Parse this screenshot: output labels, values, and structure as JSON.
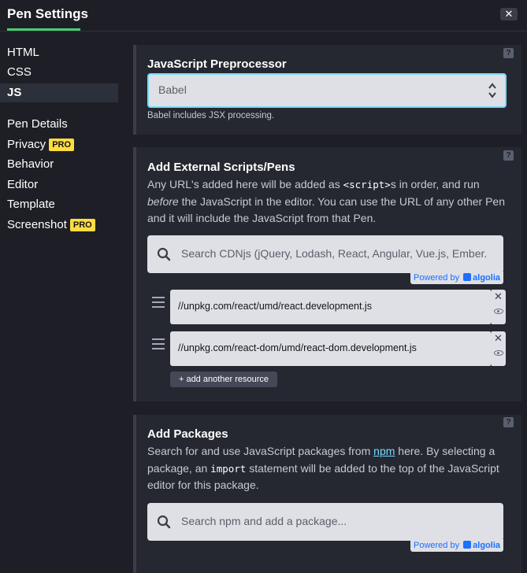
{
  "header": {
    "title": "Pen Settings",
    "close_label": "✕"
  },
  "nav": {
    "items": [
      {
        "label": "HTML"
      },
      {
        "label": "CSS"
      },
      {
        "label": "JS"
      },
      {
        "label": "Pen Details"
      },
      {
        "label": "Privacy",
        "badge": "PRO"
      },
      {
        "label": "Behavior"
      },
      {
        "label": "Editor"
      },
      {
        "label": "Template"
      },
      {
        "label": "Screenshot",
        "badge": "PRO"
      }
    ],
    "active": "JS"
  },
  "preprocessor": {
    "title": "JavaScript Preprocessor",
    "selected": "Babel",
    "note": "Babel includes JSX processing.",
    "help": "?"
  },
  "external": {
    "title": "Add External Scripts/Pens",
    "help": "?",
    "desc_1": "Any URL's added here will be added as ",
    "desc_code": "<script>",
    "desc_2": "s in order, and run ",
    "desc_em": "before",
    "desc_3": " the JavaScript in the editor. You can use the URL of any other Pen and it will include the JavaScript from that Pen.",
    "search_placeholder": "Search CDNjs (jQuery, Lodash, React, Angular, Vue.js, Ember.",
    "powered_by": "Powered by",
    "powered_brand": "algolia",
    "resources": [
      "//unpkg.com/react/umd/react.development.js",
      "//unpkg.com/react-dom/umd/react-dom.development.js"
    ],
    "add_label": "+ add another resource"
  },
  "packages": {
    "title": "Add Packages",
    "help": "?",
    "desc_1": "Search for and use JavaScript packages from ",
    "desc_link": "npm",
    "desc_2": " here. By selecting a package, an ",
    "desc_code": "import",
    "desc_3": " statement will be added to the top of the JavaScript editor for this package.",
    "search_placeholder": "Search npm and add a package...",
    "powered_by": "Powered by",
    "powered_brand": "algolia"
  },
  "colors": {
    "accent": "#47cf73",
    "focus": "#76daff",
    "pro": "#ffdd40"
  },
  "icons": [
    "close-icon",
    "help-icon",
    "search-icon",
    "drag-handle-icon",
    "eye-icon",
    "chevron-updown-icon",
    "algolia-icon"
  ]
}
